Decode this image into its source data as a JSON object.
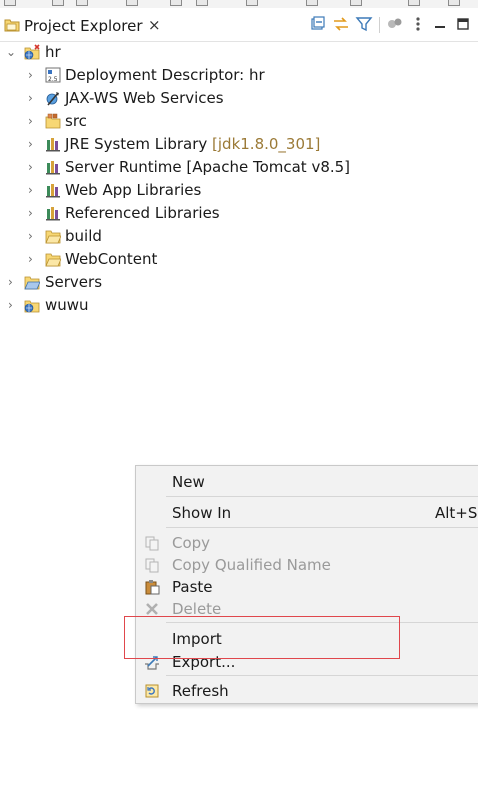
{
  "view": {
    "tab_label": "Project Explorer",
    "close_glyph": "×",
    "toolbar_icons": [
      "collapse-all-icon",
      "link-with-editor-icon",
      "filter-icon",
      "focus-icon",
      "view-menu-icon",
      "minimize-icon",
      "maximize-icon"
    ]
  },
  "tree": {
    "project": "hr",
    "children": [
      {
        "label": "Deployment Descriptor: hr",
        "icon": "deployment-descriptor-icon"
      },
      {
        "label": "JAX-WS Web Services",
        "icon": "web-services-icon"
      },
      {
        "label": "src",
        "icon": "source-folder-icon"
      },
      {
        "label": "JRE System Library",
        "decoration": "[jdk1.8.0_301]",
        "icon": "library-icon"
      },
      {
        "label": "Server Runtime [Apache Tomcat v8.5]",
        "icon": "library-icon"
      },
      {
        "label": "Web App Libraries",
        "icon": "library-icon"
      },
      {
        "label": "Referenced Libraries",
        "icon": "library-icon"
      },
      {
        "label": "build",
        "icon": "folder-icon"
      },
      {
        "label": "WebContent",
        "icon": "folder-icon"
      }
    ],
    "roots": [
      {
        "label": "Servers",
        "icon": "servers-folder-icon"
      },
      {
        "label": "wuwu",
        "icon": "project-icon"
      }
    ]
  },
  "context_menu": {
    "new": "New",
    "show_in": "Show In",
    "show_in_accel": "Alt+Sh",
    "copy": "Copy",
    "copy_qualified_name": "Copy Qualified Name",
    "paste": "Paste",
    "delete": "Delete",
    "import": "Import",
    "export": "Export...",
    "refresh": "Refresh"
  },
  "colors": {
    "decoration": "#9b7a37",
    "highlight_box": "#e0474c",
    "disabled_text": "#9a9a9a"
  }
}
